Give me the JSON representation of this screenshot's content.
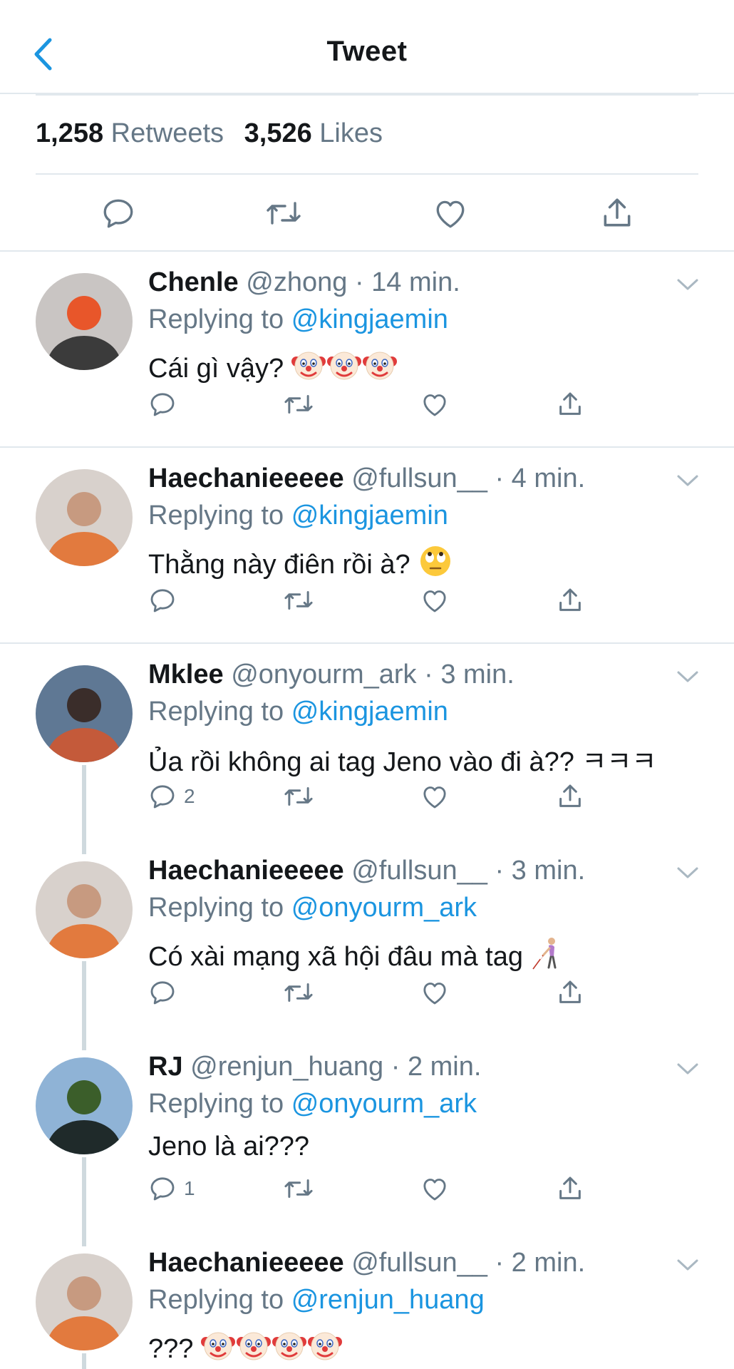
{
  "header": {
    "title": "Tweet"
  },
  "stats": {
    "retweets_count": "1,258",
    "retweets_label": "Retweets",
    "likes_count": "3,526",
    "likes_label": "Likes"
  },
  "replies": [
    {
      "name": "Chenle",
      "handle": "@zhong",
      "dot": "·",
      "time": "14 min.",
      "replying_label": "Replying to",
      "mention": "@kingjaemin",
      "text": "Cái gì vậy?",
      "emojis": [
        "clown-face-emoji",
        "clown-face-emoji",
        "clown-face-emoji"
      ],
      "reply_count": ""
    },
    {
      "name": "Haechanieeeee",
      "handle": "@fullsun__",
      "dot": "·",
      "time": "4 min.",
      "replying_label": "Replying to",
      "mention": "@kingjaemin",
      "text": "Thằng này điên rồi à?",
      "emojis": [
        "eye-roll-emoji"
      ],
      "reply_count": ""
    },
    {
      "name": "Mklee",
      "handle": "@onyourm_ark",
      "dot": "·",
      "time": "3 min.",
      "replying_label": "Replying to",
      "mention": "@kingjaemin",
      "text": "Ủa rồi không ai tag Jeno vào đi à?? ㅋㅋㅋ",
      "emojis": [],
      "reply_count": "2"
    },
    {
      "name": "Haechanieeeee",
      "handle": "@fullsun__",
      "dot": "·",
      "time": "3 min.",
      "replying_label": "Replying to",
      "mention": "@onyourm_ark",
      "text": "Có xài mạng xã hội đâu mà tag",
      "emojis": [
        "person-with-cane-emoji"
      ],
      "reply_count": ""
    },
    {
      "name": "RJ",
      "handle": "@renjun_huang",
      "dot": "·",
      "time": "2 min.",
      "replying_label": "Replying to",
      "mention": "@onyourm_ark",
      "text": "Jeno là ai???",
      "emojis": [],
      "reply_count": "1"
    },
    {
      "name": "Haechanieeeee",
      "handle": "@fullsun__",
      "dot": "·",
      "time": "2 min.",
      "replying_label": "Replying to",
      "mention": "@renjun_huang",
      "text": "???",
      "emojis": [
        "clown-face-emoji",
        "clown-face-emoji",
        "clown-face-emoji",
        "clown-face-emoji"
      ],
      "reply_count": ""
    }
  ]
}
